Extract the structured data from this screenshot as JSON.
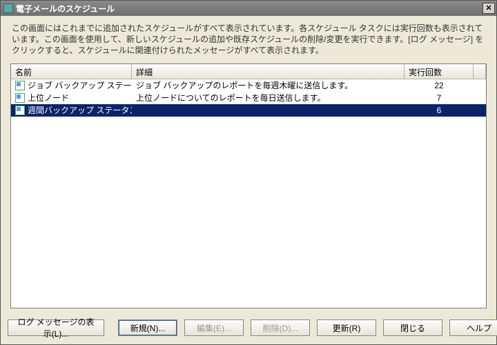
{
  "window": {
    "title": "電子メールのスケジュール"
  },
  "description": "この画面にはこれまでに追加されたスケジュールがすべて表示されています。各スケジュール タスクには実行回数も表示されています。この画面を使用して、新しいスケジュールの追加や既存スケジュールの削除/変更を実行できます。[ログ メッセージ] をクリックすると、スケジュールに関連付けられたメッセージがすべて表示されます。",
  "columns": {
    "name": "名前",
    "detail": "詳細",
    "count": "実行回数"
  },
  "rows": [
    {
      "name": "ジョブ バックアップ ステータス",
      "detail": "ジョブ バックアップのレポートを毎週木曜に送信します。",
      "count": "22",
      "selected": false
    },
    {
      "name": "上位ノード",
      "detail": "上位ノードについてのレポートを毎日送信します。",
      "count": "7",
      "selected": false
    },
    {
      "name": "週間バックアップ ステータス",
      "detail": "",
      "count": "6",
      "selected": true
    }
  ],
  "buttons": {
    "log": "ログ メッセージの表示(L)...",
    "new": "新規(N)...",
    "edit": "編集(E)...",
    "delete": "削除(D)...",
    "update": "更新(R)",
    "close": "閉じる",
    "help": "ヘルプ"
  }
}
